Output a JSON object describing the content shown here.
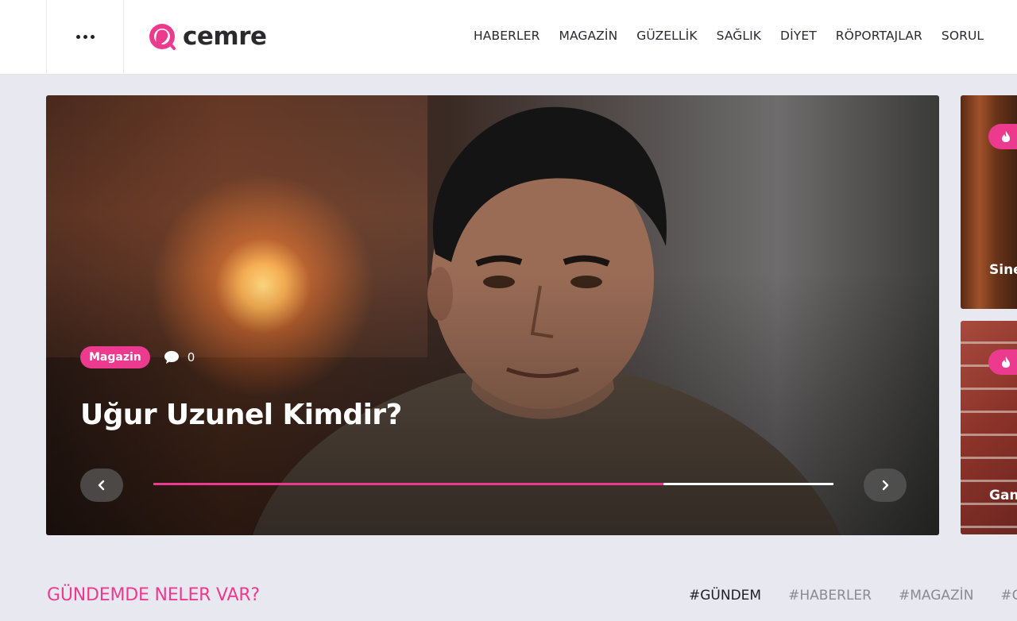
{
  "header": {
    "logo_text": "cemre",
    "nav": [
      "HABERLER",
      "MAGAZİN",
      "GÜZELLİK",
      "SAĞLIK",
      "DİYET",
      "RÖPORTAJLAR",
      "SORUL"
    ]
  },
  "hero": {
    "category": "Magazin",
    "comment_count": "0",
    "title": "Uğur Uzunel Kimdir?",
    "progress_fraction": 0.75
  },
  "side_cards": [
    {
      "label": "Sine"
    },
    {
      "label": "Gan"
    }
  ],
  "section": {
    "title": "GÜNDEMDE NELER VAR?",
    "tags": [
      "#GÜNDEM",
      "#HABERLER",
      "#MAGAZİN",
      "#G"
    ]
  },
  "colors": {
    "accent": "#ec3b8e",
    "background": "#e8e8f0"
  }
}
